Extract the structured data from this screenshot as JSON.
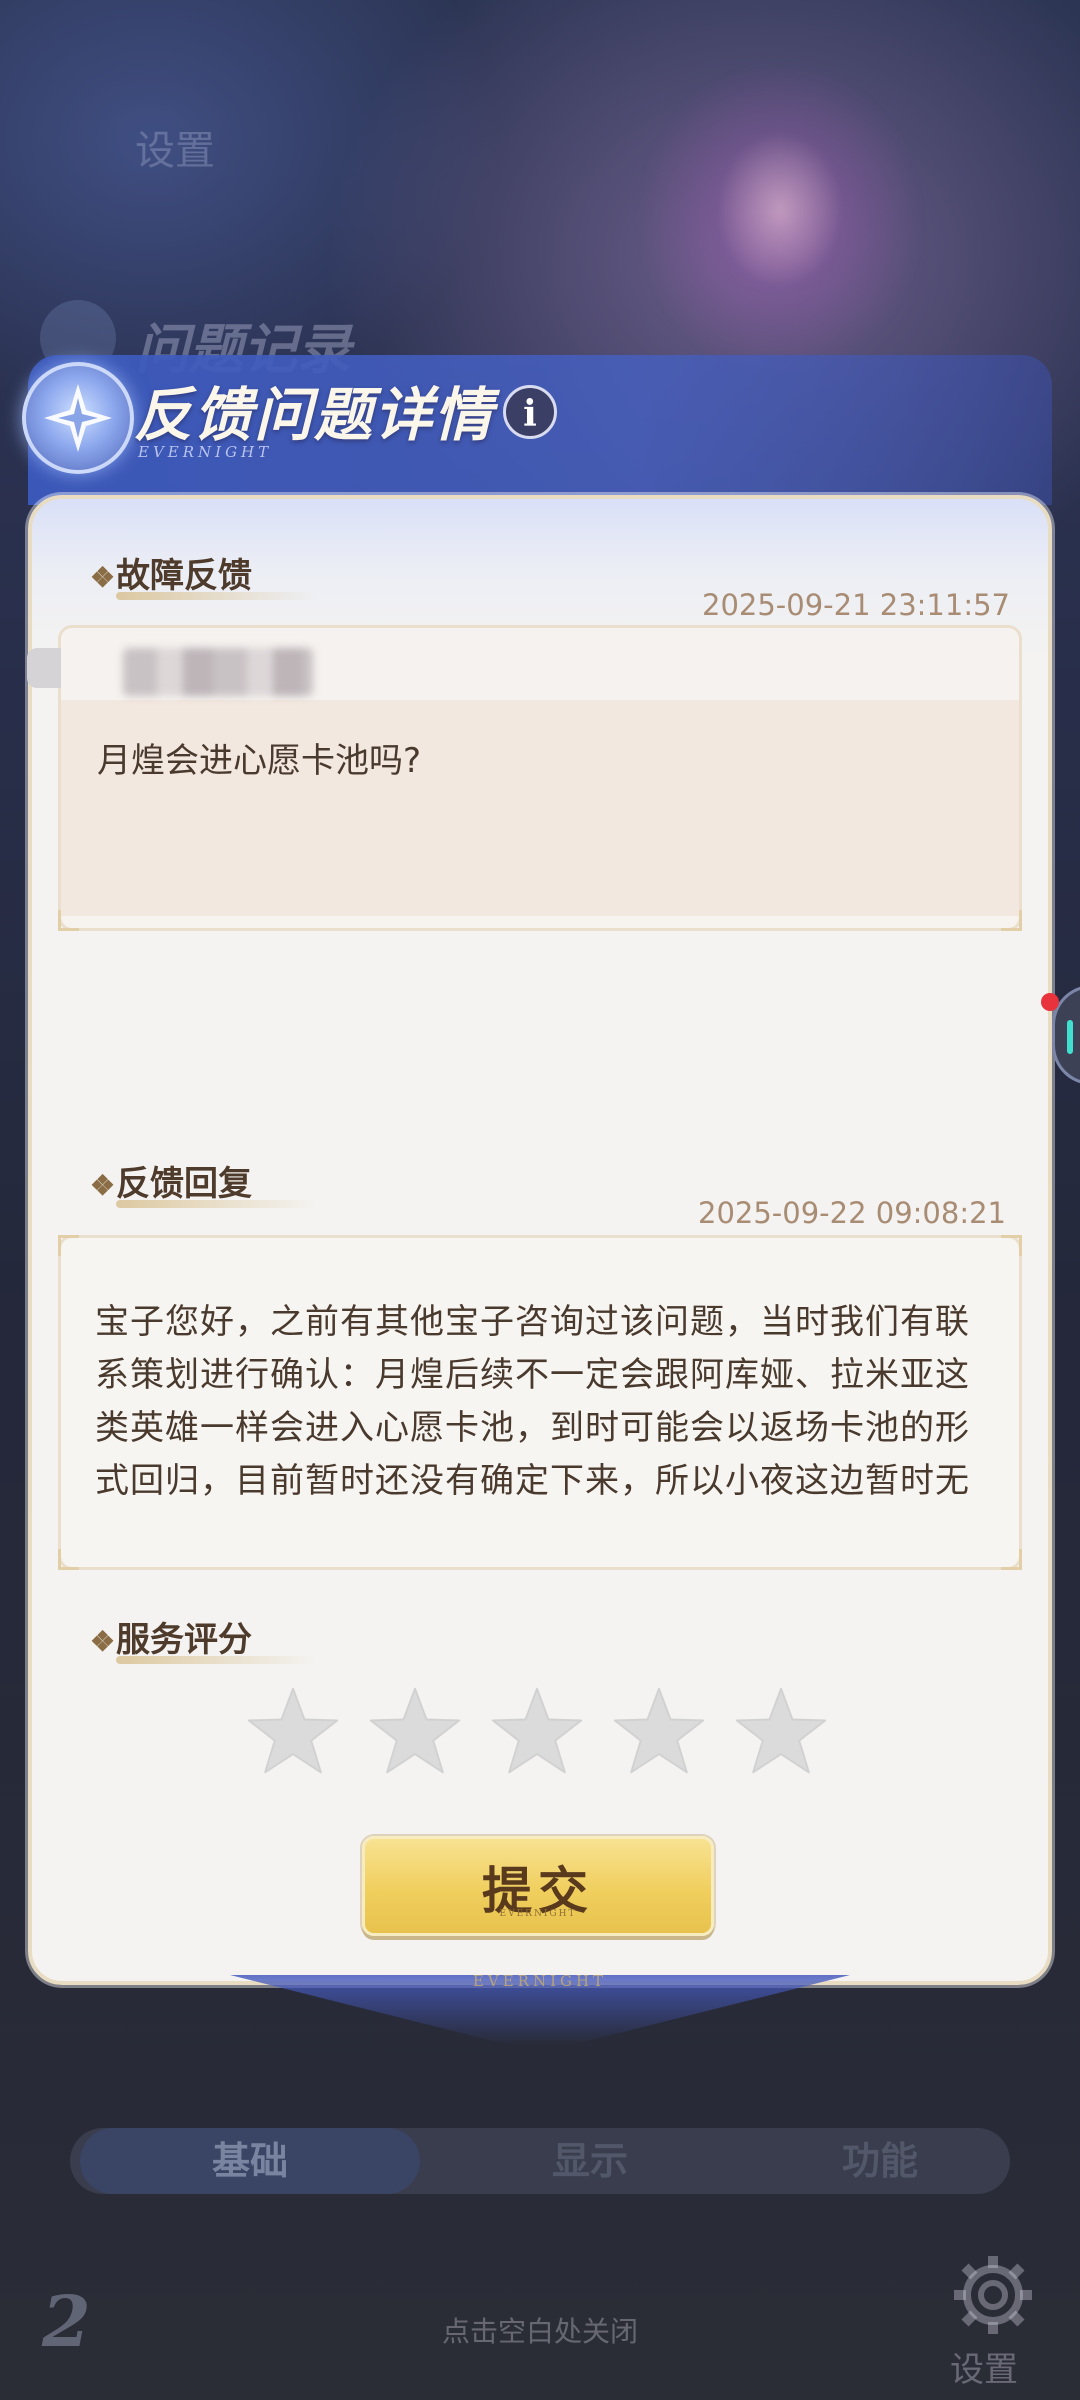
{
  "background": {
    "settings_title": "设置",
    "record_title": "问题记录",
    "tabs": [
      "基础",
      "显示",
      "功能"
    ],
    "close_hint": "点击空白处关闭",
    "settings_label": "设置",
    "corner_logo": "2"
  },
  "dialog": {
    "title": "反馈问题详情",
    "subtitle": "EVERNIGHT",
    "info_label": "i",
    "brand_footer": "EVERNIGHT"
  },
  "issue": {
    "section_title": "故障反馈",
    "timestamp": "2025-09-21 23:11:57",
    "question": "月煌会进心愿卡池吗?"
  },
  "reply": {
    "section_title": "反馈回复",
    "timestamp": "2025-09-22 09:08:21",
    "text": "宝子您好，之前有其他宝子咨询过该问题，当时我们有联系策划进行确认：月煌后续不一定会跟阿库娅、拉米亚这类英雄一样会进入心愿卡池，到时可能会以返场卡池的形式回归，目前暂时还没有确定下来，所以小夜这边暂时无"
  },
  "rating": {
    "section_title": "服务评分",
    "max_stars": 5,
    "selected_stars": 0
  },
  "submit": {
    "label": "提交",
    "sub_label": "EVERNIGHT"
  },
  "colors": {
    "header_blue": "#4a63c4",
    "card_bg": "#f4f3f1",
    "text_brown": "#4a3a2e",
    "timestamp": "#a88c74",
    "submit_gold": "#f0cf5e",
    "star_empty": "#dcdbdb"
  }
}
